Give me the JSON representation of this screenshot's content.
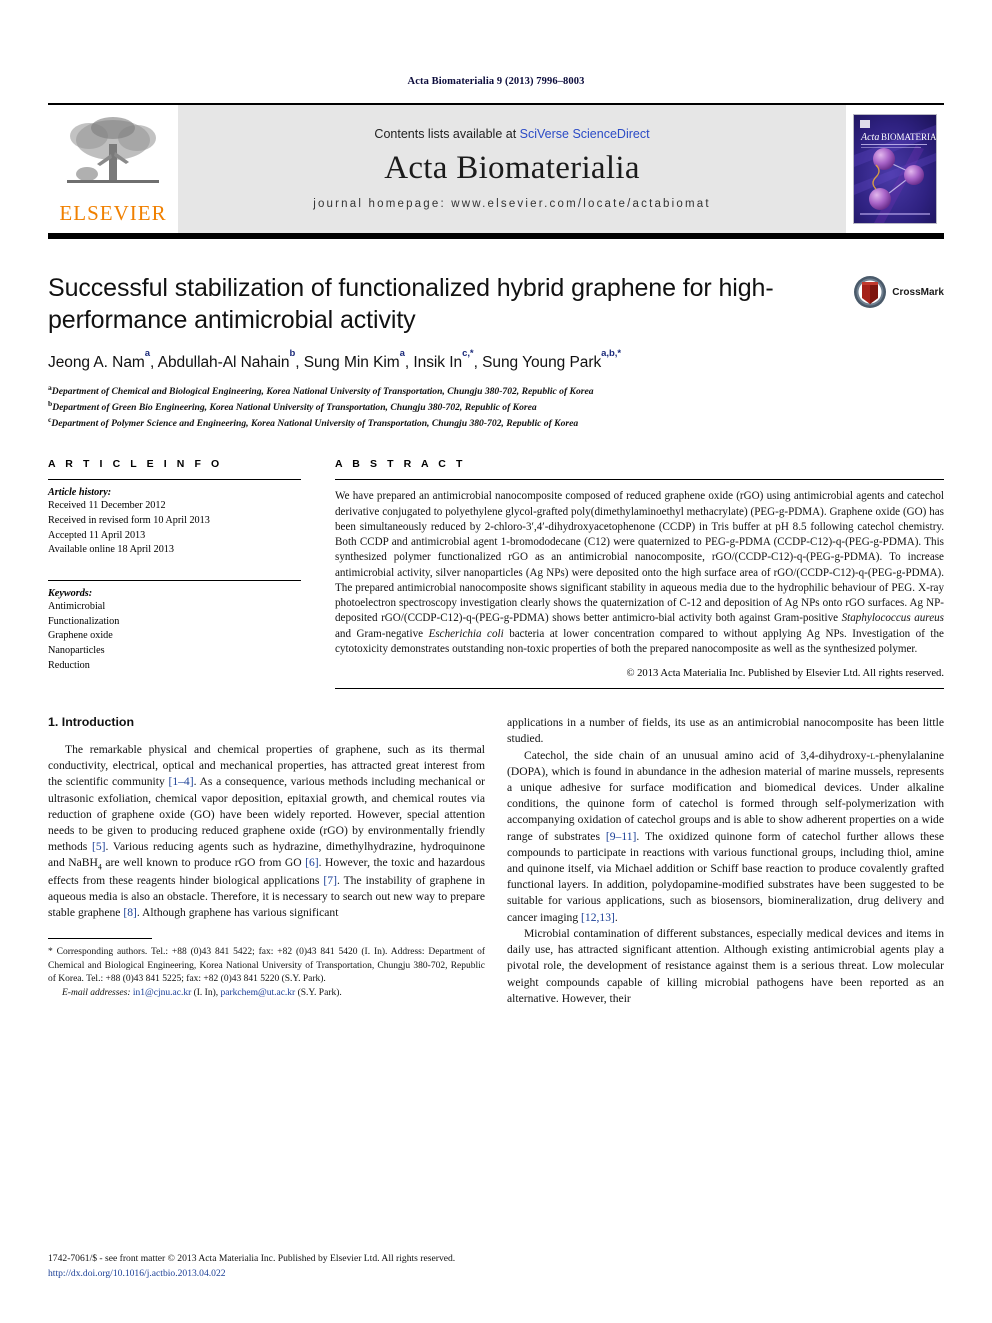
{
  "running_head": "Acta Biomaterialia 9 (2013) 7996–8003",
  "masthead": {
    "contents_prefix": "Contents lists available at ",
    "contents_link": "SciVerse ScienceDirect",
    "journal_title": "Acta Biomaterialia",
    "homepage": "journal homepage: www.elsevier.com/locate/actabiomat",
    "publisher_logo_text": "ELSEVIER",
    "cover_title_italic": "Acta",
    "cover_title_rest": "BIOMATERIALIA"
  },
  "title": "Successful stabilization of functionalized hybrid graphene for high-performance antimicrobial activity",
  "crossmark_label": "CrossMark",
  "authors": [
    {
      "name": "Jeong A. Nam",
      "sup": "a",
      "sep": ", "
    },
    {
      "name": "Abdullah-Al Nahain",
      "sup": "b",
      "sep": ", "
    },
    {
      "name": "Sung Min Kim",
      "sup": "a",
      "sep": ", "
    },
    {
      "name": "Insik In",
      "sup": "c,*",
      "sep": ", "
    },
    {
      "name": "Sung Young Park",
      "sup": "a,b,*",
      "sep": ""
    }
  ],
  "affiliations": [
    {
      "marker": "a",
      "text": "Department of Chemical and Biological Engineering, Korea National University of Transportation, Chungju 380-702, Republic of Korea"
    },
    {
      "marker": "b",
      "text": "Department of Green Bio Engineering, Korea National University of Transportation, Chungju 380-702, Republic of Korea"
    },
    {
      "marker": "c",
      "text": "Department of Polymer Science and Engineering, Korea National University of Transportation, Chungju 380-702, Republic of Korea"
    }
  ],
  "article_info": {
    "heading": "A R T I C L E   I N F O",
    "history_label": "Article history:",
    "history": [
      "Received 11 December 2012",
      "Received in revised form 10 April 2013",
      "Accepted 11 April 2013",
      "Available online 18 April 2013"
    ],
    "keywords_label": "Keywords:",
    "keywords": [
      "Antimicrobial",
      "Functionalization",
      "Graphene oxide",
      "Nanoparticles",
      "Reduction"
    ]
  },
  "abstract": {
    "heading": "A B S T R A C T",
    "paragraph_1": "We have prepared an antimicrobial nanocomposite composed of reduced graphene oxide (rGO) using antimicrobial agents and catechol derivative conjugated to polyethylene glycol-grafted poly(dimethylaminoethyl methacrylate) (PEG-g-PDMA). Graphene oxide (GO) has been simultaneously reduced by 2-chloro-3′,4′-dihydroxyacetophenone (CCDP) in Tris buffer at pH 8.5 following catechol chemistry. Both CCDP and antimicrobial agent 1-bromododecane (C12) were quaternized to PEG-g-PDMA (CCDP-C12)-q-(PEG-g-PDMA). This synthesized polymer functionalized rGO as an antimicrobial nanocomposite, rGO/(CCDP-C12)-q-(PEG-g-PDMA). To increase antimicrobial activity, silver nanoparticles (Ag NPs) were deposited onto the high surface area of rGO/(CCDP-C12)-q-(PEG-g-PDMA). The prepared antimicrobial nanocomposite shows significant stability in aqueous media due to the hydrophilic behaviour of PEG. X-ray photoelectron spectroscopy investigation clearly shows the quaternization of C-12 and deposition of Ag NPs onto rGO surfaces. Ag NP-deposited rGO/(CCDP-C12)-q-(PEG-g-PDMA) shows better antimicro-bial activity both against Gram-positive ",
    "italic_1": "Staphylococcus aureus",
    "mid_1": " and Gram-negative ",
    "italic_2": "Escherichia coli",
    "tail": " bacteria at lower concentration compared to without applying Ag NPs. Investigation of the cytotoxicity demonstrates outstanding non-toxic properties of both the prepared nanocomposite as well as the synthesized polymer.",
    "copyright": "© 2013 Acta Materialia Inc. Published by Elsevier Ltd. All rights reserved."
  },
  "introduction": {
    "section_title": "1. Introduction",
    "left_p1_a": "The remarkable physical and chemical properties of graphene, such as its thermal conductivity, electrical, optical and mechanical properties, has attracted great interest from the scientific community ",
    "left_p1_ref1": "[1–4]",
    "left_p1_b": ". As a consequence, various methods including mechanical or ultrasonic exfoliation, chemical vapor deposition, epitaxial growth, and chemical routes via reduction of graphene oxide (GO) have been widely reported. However, special attention needs to be given to producing reduced graphene oxide (rGO) by environmentally friendly methods ",
    "left_p1_ref2": "[5]",
    "left_p1_c": ". Various reducing agents such as hydrazine, dimethylhydrazine, hydroquinone and NaBH",
    "left_p1_sub": "4",
    "left_p1_d": " are well known to produce rGO from GO ",
    "left_p1_ref3": "[6]",
    "left_p1_e": ". However, the toxic and hazardous effects from these reagents hinder biological applications ",
    "left_p1_ref4": "[7]",
    "left_p1_f": ". The instability of graphene in aqueous media is also an obstacle. Therefore, it is necessary to search out new way to prepare stable graphene ",
    "left_p1_ref5": "[8]",
    "left_p1_g": ". Although graphene has various significant",
    "right_p1": "applications in a number of fields, its use as an antimicrobial nanocomposite has been little studied.",
    "right_p2_a": "Catechol, the side chain of an unusual amino acid of 3,4-dihydroxy-",
    "right_p2_sc": "l",
    "right_p2_b": "-phenylalanine (DOPA), which is found in abundance in the adhesion material of marine mussels, represents a unique adhesive for surface modification and biomedical devices. Under alkaline conditions, the quinone form of catechol is formed through self-polymerization with accompanying oxidation of catechol groups and is able to show adherent properties on a wide range of substrates ",
    "right_p2_ref1": "[9–11]",
    "right_p2_c": ". The oxidized quinone form of catechol further allows these compounds to participate in reactions with various functional groups, including thiol, amine and quinone itself, via Michael addition or Schiff base reaction to produce covalently grafted functional layers. In addition, polydopamine-modified substrates have been suggested to be suitable for various applications, such as biosensors, biomineralization, drug delivery and cancer imaging ",
    "right_p2_ref2": "[12,13]",
    "right_p2_d": ".",
    "right_p3": "Microbial contamination of different substances, especially medical devices and items in daily use, has attracted significant attention. Although existing antimicrobial agents play a pivotal role, the development of resistance against them is a serious threat. Low molecular weight compounds capable of killing microbial pathogens have been reported as an alternative. However, their"
  },
  "footnotes": {
    "corresponding": "* Corresponding authors. Tel.: +88 (0)43 841 5422; fax: +82 (0)43 841 5420 (I. In). Address: Department of Chemical and Biological Engineering, Korea National University of Transportation, Chungju 380-702, Republic of Korea. Tel.: +88 (0)43 841 5225; fax: +82 (0)43 841 5220 (S.Y. Park).",
    "email_label": "E-mail addresses:",
    "email_1": "in1@cjnu.ac.kr",
    "email_1_owner": " (I. In), ",
    "email_2": "parkchem@ut.ac.kr",
    "email_2_owner": " (S.Y. Park)."
  },
  "publisher_footer": {
    "line_1": "1742-7061/$ - see front matter © 2013 Acta Materialia Inc. Published by Elsevier Ltd. All rights reserved.",
    "line_2": "http://dx.doi.org/10.1016/j.actbio.2013.04.022"
  },
  "colors": {
    "link_blue": "#2b4bc6",
    "ref_blue": "#1b3f96",
    "running_head": "#0b0b3b",
    "elsevier_orange": "#f08000",
    "masthead_grey": "#e6e6e6"
  }
}
